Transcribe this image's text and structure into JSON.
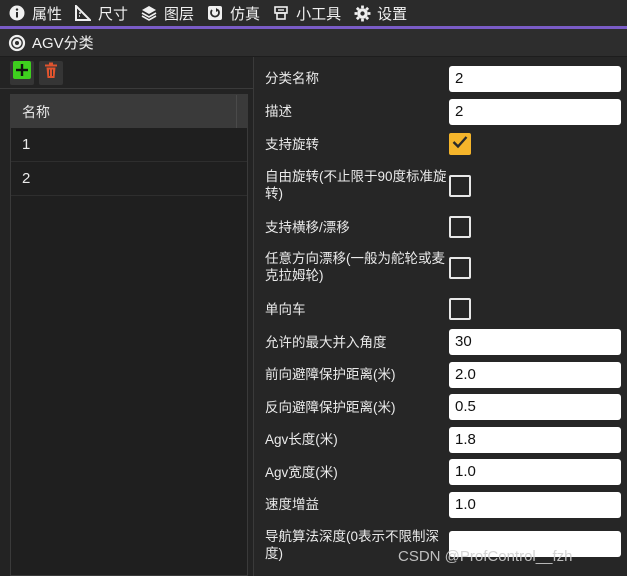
{
  "menubar": {
    "items": [
      {
        "label": "属性",
        "icon": "info-icon"
      },
      {
        "label": "尺寸",
        "icon": "ruler-icon"
      },
      {
        "label": "图层",
        "icon": "layers-icon"
      },
      {
        "label": "仿真",
        "icon": "simulation-icon"
      },
      {
        "label": "小工具",
        "icon": "tools-icon"
      },
      {
        "label": "设置",
        "icon": "gear-icon"
      }
    ]
  },
  "panel": {
    "title": "AGV分类",
    "icon": "settings-icon"
  },
  "toolbar": {
    "add_icon": "add-icon",
    "delete_icon": "trash-icon"
  },
  "list": {
    "header": "名称",
    "rows": [
      "1",
      "2"
    ]
  },
  "form": {
    "fields": [
      {
        "label": "分类名称",
        "type": "text",
        "value": "2"
      },
      {
        "label": "描述",
        "type": "text",
        "value": "2"
      },
      {
        "label": "支持旋转",
        "type": "checkbox",
        "checked": true
      },
      {
        "label": "自由旋转(不止限于90度标准旋转)",
        "type": "checkbox",
        "checked": false
      },
      {
        "label": "支持横移/漂移",
        "type": "checkbox",
        "checked": false
      },
      {
        "label": "任意方向漂移(一般为舵轮或麦克拉姆轮)",
        "type": "checkbox",
        "checked": false
      },
      {
        "label": "单向车",
        "type": "checkbox",
        "checked": false
      },
      {
        "label": "允许的最大并入角度",
        "type": "text",
        "value": "30"
      },
      {
        "label": "前向避障保护距离(米)",
        "type": "text",
        "value": "2.0"
      },
      {
        "label": "反向避障保护距离(米)",
        "type": "text",
        "value": "0.5"
      },
      {
        "label": "Agv长度(米)",
        "type": "text",
        "value": "1.8"
      },
      {
        "label": "Agv宽度(米)",
        "type": "text",
        "value": "1.0"
      },
      {
        "label": "速度增益",
        "type": "text",
        "value": "1.0"
      },
      {
        "label": "导航算法深度(0表示不限制深度)",
        "type": "text",
        "value": ""
      }
    ]
  },
  "watermark": "CSDN @ProfControl__fzh",
  "colors": {
    "accent_line": "#7a5cc7",
    "checkbox_on": "#f5b52b",
    "add_green": "#3ecf1e",
    "delete_red": "#e0542e"
  }
}
